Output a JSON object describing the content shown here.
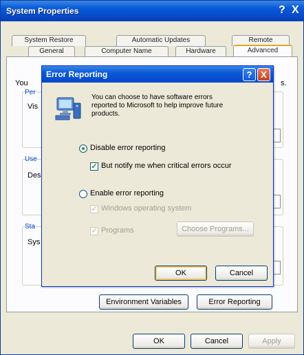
{
  "window": {
    "title": "System Properties",
    "help_glyph": "?",
    "close_glyph": "X"
  },
  "tabs_row1": [
    "System Restore",
    "Automatic Updates",
    "Remote"
  ],
  "tabs_row2": [
    "General",
    "Computer Name",
    "Hardware",
    "Advanced"
  ],
  "active_tab": "Advanced",
  "panel": {
    "intro_partial": "You",
    "intro_tail": "s.",
    "groups": [
      {
        "label": "Per",
        "text": "Vis"
      },
      {
        "label": "Use",
        "text": "Des"
      },
      {
        "label": "Sta",
        "text": "Sys"
      }
    ],
    "env_button": "Environment Variables",
    "error_button": "Error Reporting"
  },
  "footer": {
    "ok": "OK",
    "cancel": "Cancel",
    "apply": "Apply"
  },
  "dialog": {
    "title": "Error Reporting",
    "help_glyph": "?",
    "close_glyph": "X",
    "icon": "computer-error-report-icon",
    "description": "You can choose to have software errors reported to Microsoft to help improve future products.",
    "disable_option": "Disable error reporting",
    "disable_selected": true,
    "notify_option": "But notify me when critical errors occur",
    "notify_checked": true,
    "enable_option": "Enable error reporting",
    "windows_option": "Windows operating system",
    "programs_option": "Programs",
    "choose_programs": "Choose Programs...",
    "ok": "OK",
    "cancel": "Cancel"
  }
}
